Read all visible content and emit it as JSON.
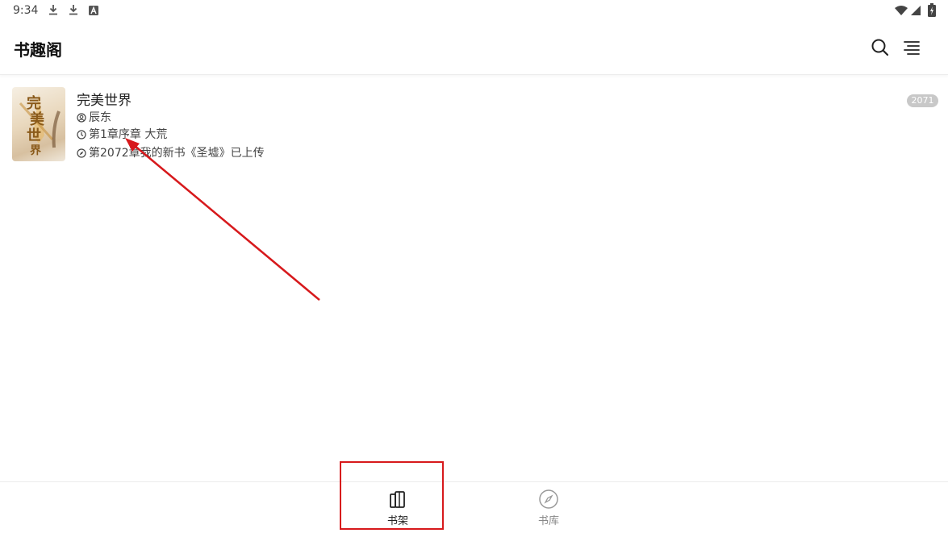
{
  "status_bar": {
    "time": "9:34",
    "left_icons": [
      "download-icon",
      "download-icon",
      "a-box-icon"
    ],
    "right_icons": [
      "wifi-icon",
      "signal-icon",
      "battery-icon"
    ]
  },
  "app_bar": {
    "title": "书趣阁",
    "actions": [
      "search-icon",
      "menu-icon"
    ]
  },
  "bookshelf": {
    "books": [
      {
        "title": "完美世界",
        "author": "辰东",
        "last_read": "第1章序章 大荒",
        "latest_chapter": "第2072章我的新书《圣墟》已上传",
        "badge": "2071",
        "cover_text": "完美世界"
      }
    ]
  },
  "bottom_nav": {
    "items": [
      {
        "label": "书架",
        "icon": "bookshelf-icon",
        "active": true
      },
      {
        "label": "书库",
        "icon": "compass-icon",
        "active": false
      }
    ]
  },
  "colors": {
    "active": "#222222",
    "inactive": "#888888",
    "annotation": "#d7191c",
    "badge": "#c8c8c8"
  }
}
